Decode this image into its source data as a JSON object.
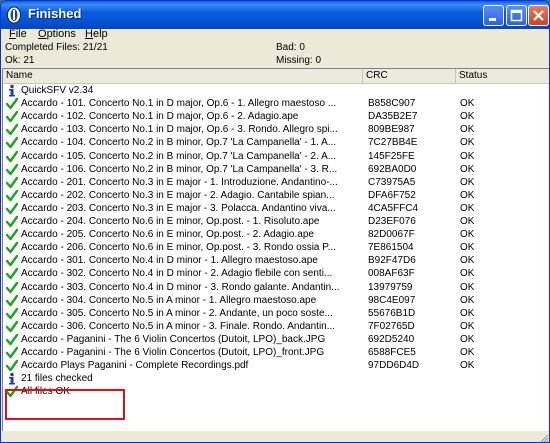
{
  "window": {
    "title": "Finished"
  },
  "menu": [
    {
      "label": "File"
    },
    {
      "label": "Options"
    },
    {
      "label": "Help"
    }
  ],
  "summary": {
    "completed": "Completed Files: 21/21",
    "bad": "Bad: 0",
    "ok": "Ok: 21",
    "missing": "Missing: 0"
  },
  "columns": {
    "name": "Name",
    "crc": "CRC",
    "status": "Status"
  },
  "rows": [
    {
      "icon": "info-icon",
      "name": "QuickSFV v2.34",
      "crc": "",
      "status": ""
    },
    {
      "icon": "check-icon",
      "name": "Accardo - 101. Concerto No.1 in D major, Op.6 - 1. Allegro maestoso ...",
      "crc": "B858C907",
      "status": "OK"
    },
    {
      "icon": "check-icon",
      "name": "Accardo - 102. Concerto No.1 in D major, Op.6 - 2. Adagio.ape",
      "crc": "DA35B2E7",
      "status": "OK"
    },
    {
      "icon": "check-icon",
      "name": "Accardo - 103. Concerto No.1 in D major, Op.6 - 3. Rondo. Allegro spi...",
      "crc": "809BE987",
      "status": "OK"
    },
    {
      "icon": "check-icon",
      "name": "Accardo - 104. Concerto No.2 in B minor, Op.7 'La Campanella' - 1. A...",
      "crc": "7C27BB4E",
      "status": "OK"
    },
    {
      "icon": "check-icon",
      "name": "Accardo - 105. Concerto No.2 in B minor, Op.7 'La Campanella' - 2. A...",
      "crc": "145F25FE",
      "status": "OK"
    },
    {
      "icon": "check-icon",
      "name": "Accardo - 106. Concerto No.2 in B minor, Op.7 'La Campanella' - 3. R...",
      "crc": "692BA0D0",
      "status": "OK"
    },
    {
      "icon": "check-icon",
      "name": "Accardo - 201. Concerto No.3 in E major - 1. Introduzione. Andantino-...",
      "crc": "C73975A5",
      "status": "OK"
    },
    {
      "icon": "check-icon",
      "name": "Accardo - 202. Concerto No.3 in E major - 2. Adagio. Cantabile spian...",
      "crc": "DFA6F752",
      "status": "OK"
    },
    {
      "icon": "check-icon",
      "name": "Accardo - 203. Concerto No.3 in E major - 3. Polacca. Andantino viva...",
      "crc": "4CA5FFC4",
      "status": "OK"
    },
    {
      "icon": "check-icon",
      "name": "Accardo - 204. Concerto No.6 in E minor, Op.post. - 1. Risoluto.ape",
      "crc": "D23EF076",
      "status": "OK"
    },
    {
      "icon": "check-icon",
      "name": "Accardo - 205. Concerto No.6 in E minor, Op.post. - 2. Adagio.ape",
      "crc": "82D0067F",
      "status": "OK"
    },
    {
      "icon": "check-icon",
      "name": "Accardo - 206. Concerto No.6 in E minor, Op.post. - 3. Rondo ossia P...",
      "crc": "7E861504",
      "status": "OK"
    },
    {
      "icon": "check-icon",
      "name": "Accardo - 301. Concerto No.4 in D minor - 1. Allegro maestoso.ape",
      "crc": "B92F47D6",
      "status": "OK"
    },
    {
      "icon": "check-icon",
      "name": "Accardo - 302. Concerto No.4 in D minor - 2. Adagio flebile con senti...",
      "crc": "008AF63F",
      "status": "OK"
    },
    {
      "icon": "check-icon",
      "name": "Accardo - 303. Concerto No.4 in D minor - 3. Rondo galante. Andantin...",
      "crc": "13979759",
      "status": "OK"
    },
    {
      "icon": "check-icon",
      "name": "Accardo - 304. Concerto No.5 in A minor - 1. Allegro maestoso.ape",
      "crc": "98C4E097",
      "status": "OK"
    },
    {
      "icon": "check-icon",
      "name": "Accardo - 305. Concerto No.5 in A minor - 2. Andante, un poco soste...",
      "crc": "55676B1D",
      "status": "OK"
    },
    {
      "icon": "check-icon",
      "name": "Accardo - 306. Concerto No.5 in A minor - 3. Finale. Rondo. Andantin...",
      "crc": "7F02765D",
      "status": "OK"
    },
    {
      "icon": "check-icon",
      "name": "Accardo - Paganini - The 6 Violin Concertos (Dutoit, LPO)_back.JPG",
      "crc": "692D5240",
      "status": "OK"
    },
    {
      "icon": "check-icon",
      "name": "Accardo - Paganini - The 6 Violin Concertos (Dutoit, LPO)_front.JPG",
      "crc": "6588FCE5",
      "status": "OK"
    },
    {
      "icon": "check-icon",
      "name": "Accardo Plays Paganini - Complete Recordings.pdf",
      "crc": "97DD6D4D",
      "status": "OK"
    },
    {
      "icon": "info-icon",
      "name": "21 files checked",
      "crc": "",
      "status": ""
    },
    {
      "icon": "check-icon",
      "name": "All files OK",
      "crc": "",
      "status": ""
    }
  ],
  "colors": {
    "check": "#1aa51a",
    "info": "#1c3fb8",
    "highlight": "#e0101a",
    "titlebar": "#0554d6"
  }
}
